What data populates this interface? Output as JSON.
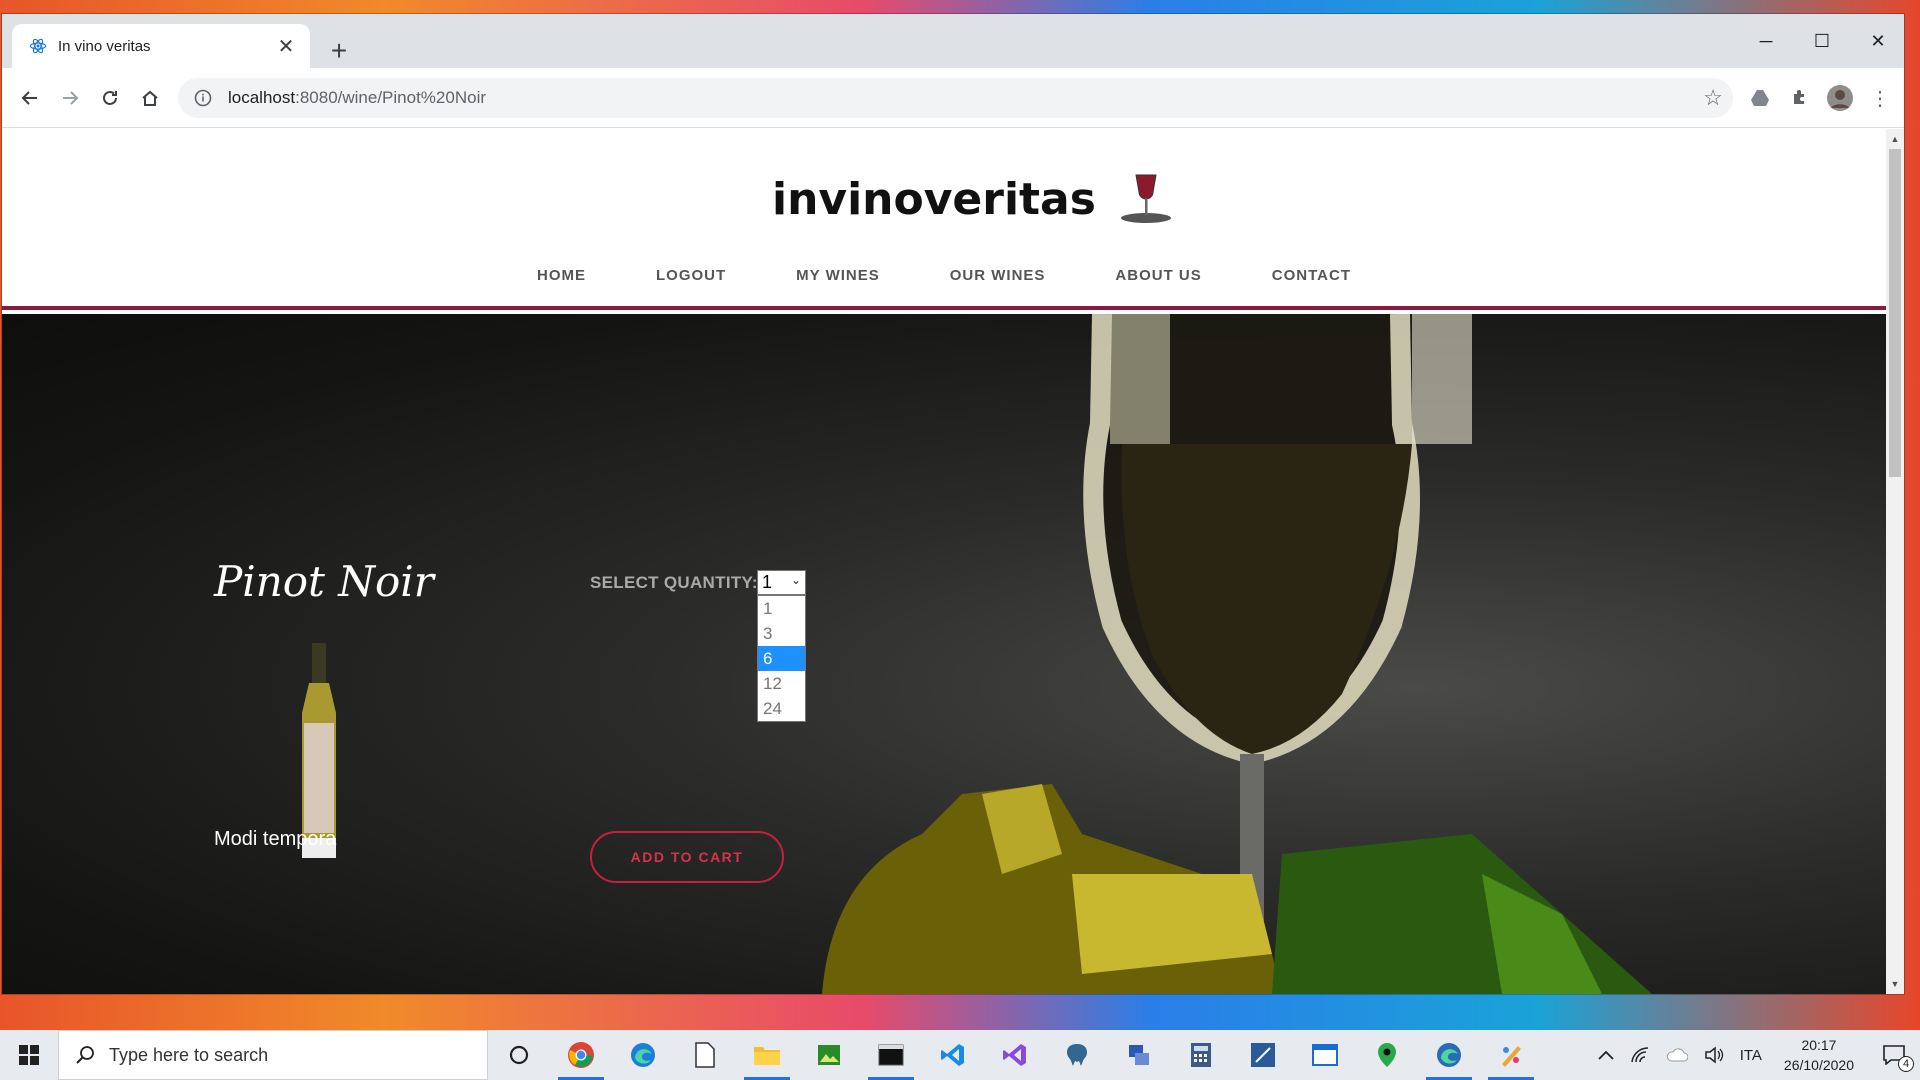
{
  "browser": {
    "tab_title": "In vino veritas",
    "url_host": "localhost",
    "url_rest": ":8080/wine/Pinot%20Noir"
  },
  "site": {
    "logo_text": "invinoveritas",
    "nav": [
      "HOME",
      "LOGOUT",
      "MY WINES",
      "OUR WINES",
      "ABOUT US",
      "CONTACT"
    ]
  },
  "product": {
    "name": "Pinot Noir",
    "description": "Modi tempora",
    "quantity_label": "SELECT QUANTITY:",
    "quantity_selected": "1",
    "quantity_options": [
      "1",
      "3",
      "6",
      "12",
      "24"
    ],
    "highlighted_option": "6",
    "add_to_cart_label": "ADD TO CART"
  },
  "taskbar": {
    "search_placeholder": "Type here to search",
    "language": "ITA",
    "time": "20:17",
    "date": "26/10/2020",
    "notifications": "4"
  }
}
